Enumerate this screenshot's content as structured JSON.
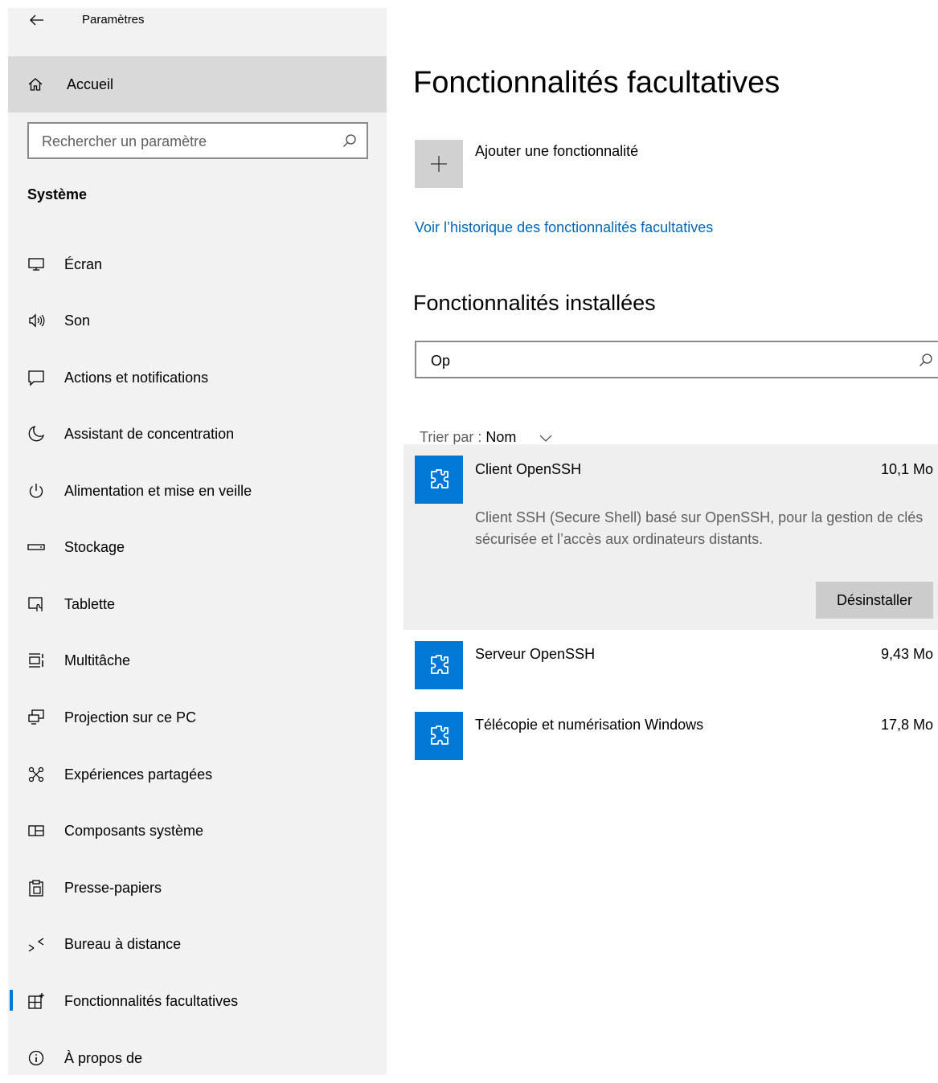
{
  "app": {
    "title": "Paramètres",
    "back_icon": "back-arrow-icon"
  },
  "sidebar": {
    "home_label": "Accueil",
    "search_placeholder": "Rechercher un paramètre",
    "section_label": "Système",
    "items": [
      {
        "label": "Écran",
        "icon": "monitor-icon"
      },
      {
        "label": "Son",
        "icon": "speaker-icon"
      },
      {
        "label": "Actions et notifications",
        "icon": "notification-icon"
      },
      {
        "label": "Assistant de concentration",
        "icon": "moon-icon"
      },
      {
        "label": "Alimentation et mise en veille",
        "icon": "power-icon"
      },
      {
        "label": "Stockage",
        "icon": "storage-icon"
      },
      {
        "label": "Tablette",
        "icon": "tablet-icon"
      },
      {
        "label": "Multitâche",
        "icon": "multitask-icon"
      },
      {
        "label": "Projection sur ce PC",
        "icon": "projection-icon"
      },
      {
        "label": "Expériences partagées",
        "icon": "shared-icon"
      },
      {
        "label": "Composants système",
        "icon": "components-icon"
      },
      {
        "label": "Presse-papiers",
        "icon": "clipboard-icon"
      },
      {
        "label": "Bureau à distance",
        "icon": "remote-desktop-icon"
      },
      {
        "label": "Fonctionnalités facultatives",
        "icon": "optional-features-icon",
        "active": true
      },
      {
        "label": "À propos de",
        "icon": "info-icon"
      }
    ]
  },
  "main": {
    "title": "Fonctionnalités facultatives",
    "add_label": "Ajouter une fonctionnalité",
    "history_link": "Voir l’historique des fonctionnalités facultatives",
    "installed_title": "Fonctionnalités installées",
    "filter_value": "Op",
    "sort_prefix": "Trier par : ",
    "sort_value": "Nom",
    "features": [
      {
        "name": "Client OpenSSH",
        "size": "10,1 Mo",
        "description": "Client SSH (Secure Shell) basé sur OpenSSH, pour la gestion de clés sécurisée et l’accès aux ordinateurs distants.",
        "expanded": true,
        "action": "Désinstaller"
      },
      {
        "name": "Serveur OpenSSH",
        "size": "9,43 Mo"
      },
      {
        "name": "Télécopie et numérisation Windows",
        "size": "17,8 Mo"
      }
    ]
  },
  "colors": {
    "accent": "#0078d7",
    "link": "#0067b8",
    "sidebar_bg": "#f2f2f2",
    "selected_bg": "#d9d9d9"
  }
}
